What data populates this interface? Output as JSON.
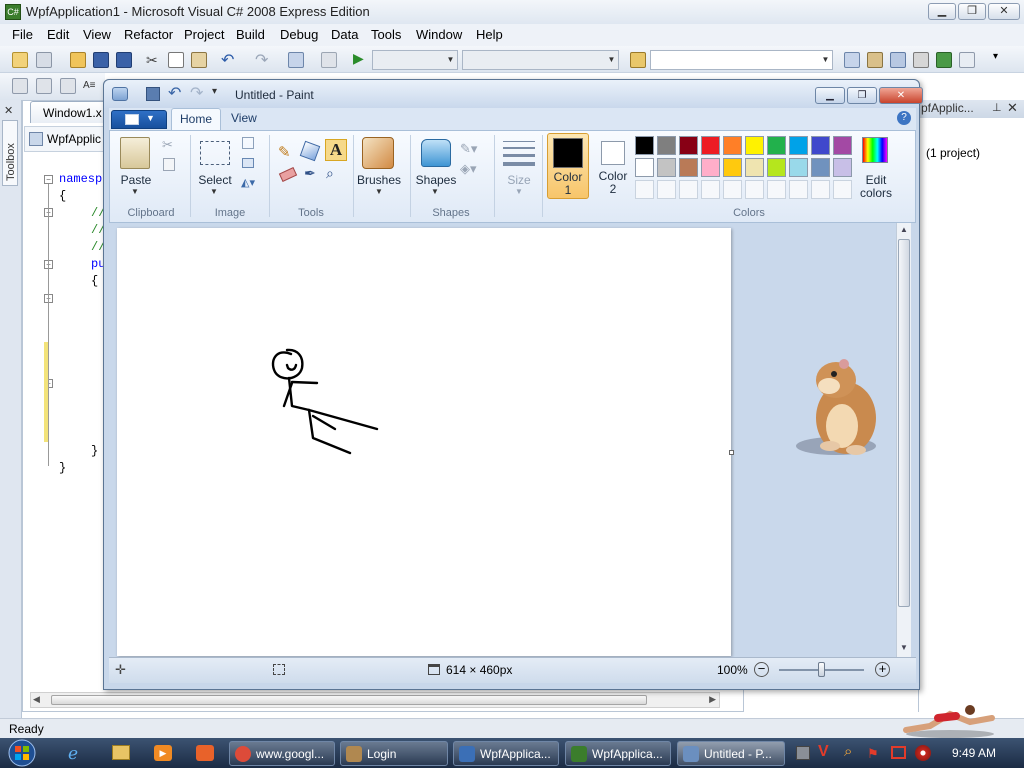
{
  "vs": {
    "title": "WpfApplication1 - Microsoft Visual C# 2008 Express Edition",
    "menu": [
      "File",
      "Edit",
      "View",
      "Refactor",
      "Project",
      "Build",
      "Debug",
      "Data",
      "Tools",
      "Window",
      "Help"
    ],
    "toolbox_label": "Toolbox",
    "doc_tab": "Window1.x",
    "nav_item": "WpfApplic",
    "code_lines": [
      "namesp",
      "{",
      "//",
      "//",
      "//",
      "pu",
      "{",
      "}",
      "}"
    ],
    "solution_title": "pfApplic...",
    "solution_text": "(1 project)",
    "status": "Ready"
  },
  "paint": {
    "title": "Untitled - Paint",
    "tabs": {
      "home": "Home",
      "view": "View"
    },
    "clipboard": {
      "paste": "Paste",
      "group": "Clipboard"
    },
    "image": {
      "select": "Select",
      "group": "Image"
    },
    "tools": {
      "group": "Tools"
    },
    "brushes": "Brushes",
    "shapes": {
      "label": "Shapes",
      "group": "Shapes"
    },
    "size": "Size",
    "color1": {
      "line1": "Color",
      "line2": "1",
      "value": "#000000"
    },
    "color2": {
      "line1": "Color",
      "line2": "2",
      "value": "#ffffff"
    },
    "colors_group": "Colors",
    "edit_colors": {
      "line1": "Edit",
      "line2": "colors"
    },
    "palette": [
      [
        "#000000",
        "#7f7f7f",
        "#880015",
        "#ed1c24",
        "#ff7f27",
        "#fff200",
        "#22b14c",
        "#00a2e8",
        "#3f48cc",
        "#a349a4"
      ],
      [
        "#ffffff",
        "#c3c3c3",
        "#b97a57",
        "#ffaec9",
        "#ffc90e",
        "#efe4b0",
        "#b5e61d",
        "#99d9ea",
        "#7092be",
        "#c8bfe7"
      ]
    ],
    "status": {
      "image_size": "614 × 460px",
      "zoom": "100%"
    }
  },
  "taskbar": {
    "items": [
      {
        "label": "www.googl...",
        "color": "#dd4b39"
      },
      {
        "label": "Login",
        "color": "#b08850"
      },
      {
        "label": "WpfApplica...",
        "color": "#3b6fb6"
      },
      {
        "label": "WpfApplica...",
        "color": "#3b7d2c"
      },
      {
        "label": "Untitled - P...",
        "color": "#6b8fbf"
      }
    ],
    "clock": "9:49 AM"
  }
}
